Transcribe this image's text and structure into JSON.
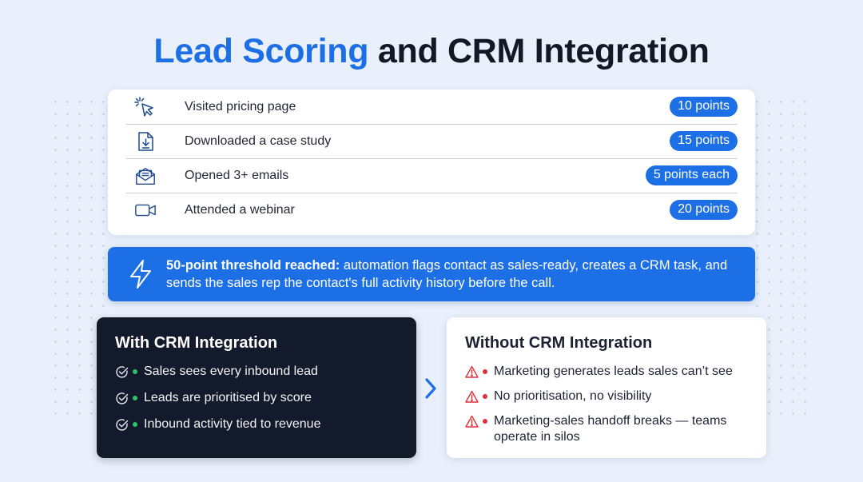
{
  "title": {
    "accent": "Lead Scoring",
    "rest": "and CRM Integration"
  },
  "scoring": [
    {
      "icon": "cursor-click-icon",
      "label": "Visited pricing page",
      "points": "10 points"
    },
    {
      "icon": "download-document-icon",
      "label": "Downloaded a case study",
      "points": "15 points"
    },
    {
      "icon": "open-envelope-icon",
      "label": "Opened 3+ emails",
      "points": "5 points each"
    },
    {
      "icon": "video-camera-icon",
      "label": "Attended a webinar",
      "points": "20 points"
    }
  ],
  "threshold": {
    "icon": "lightning-bolt-icon",
    "bold": "50-point threshold reached:",
    "text": " automation flags contact as sales-ready, creates a CRM task, and sends the sales rep the contact's full activity history before the call."
  },
  "with_crm": {
    "title": "With CRM Integration",
    "items": [
      "Sales sees every inbound lead",
      "Leads are prioritised by score",
      "Inbound activity tied to revenue"
    ]
  },
  "without_crm": {
    "title": "Without CRM Integration",
    "items": [
      "Marketing generates leads sales can’t see",
      "No prioritisation, no visibility",
      "Marketing-sales handoff breaks — teams operate in silos"
    ]
  },
  "colors": {
    "accent": "#1c6fe4",
    "dark_panel": "#131a2b",
    "positive": "#2ec36a",
    "negative": "#e0303a",
    "background": "#e9f0fb"
  }
}
